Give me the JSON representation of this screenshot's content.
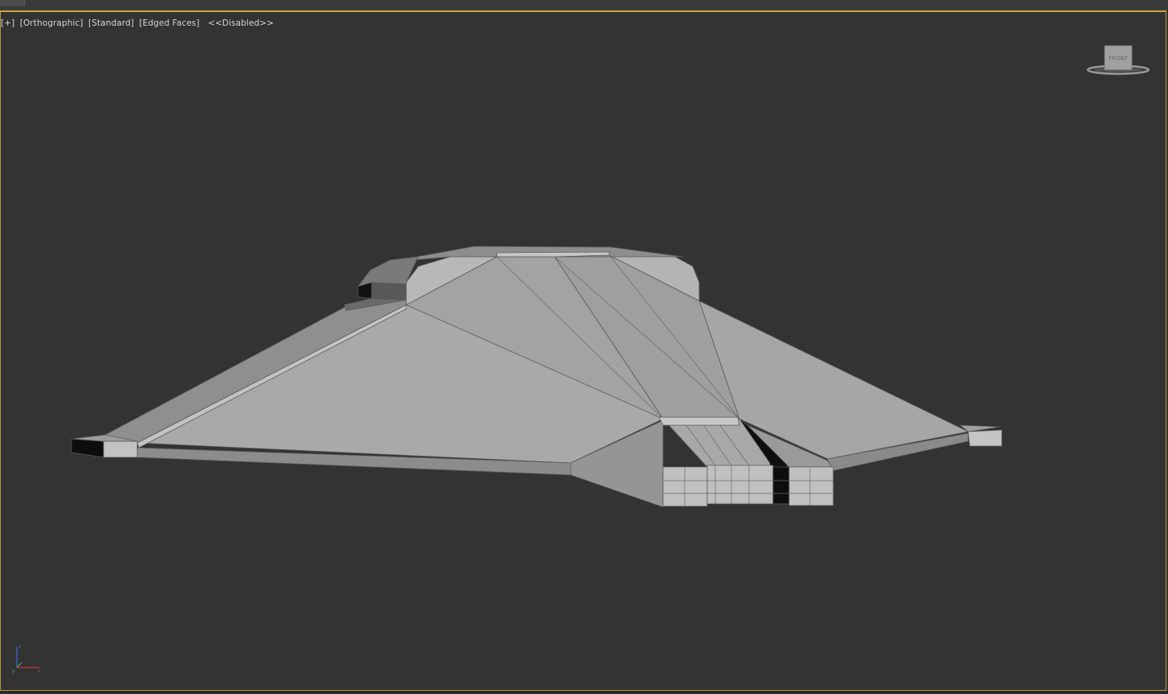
{
  "viewport": {
    "menu_plus": "[+]",
    "view_type": "[Orthographic]",
    "shading": "[Standard]",
    "edged_faces": "[Edged Faces]",
    "status": "<<Disabled>>"
  },
  "viewcube": {
    "face_label": "FRONT"
  },
  "axis": {
    "x": "x",
    "y": "y",
    "z": "z"
  },
  "colors": {
    "viewport_bg": "#333333",
    "active_border": "#c9a93f",
    "mesh_light": "#b4b4b4",
    "mesh_mid": "#9a9a9a",
    "mesh_dark": "#7c7c7c"
  }
}
